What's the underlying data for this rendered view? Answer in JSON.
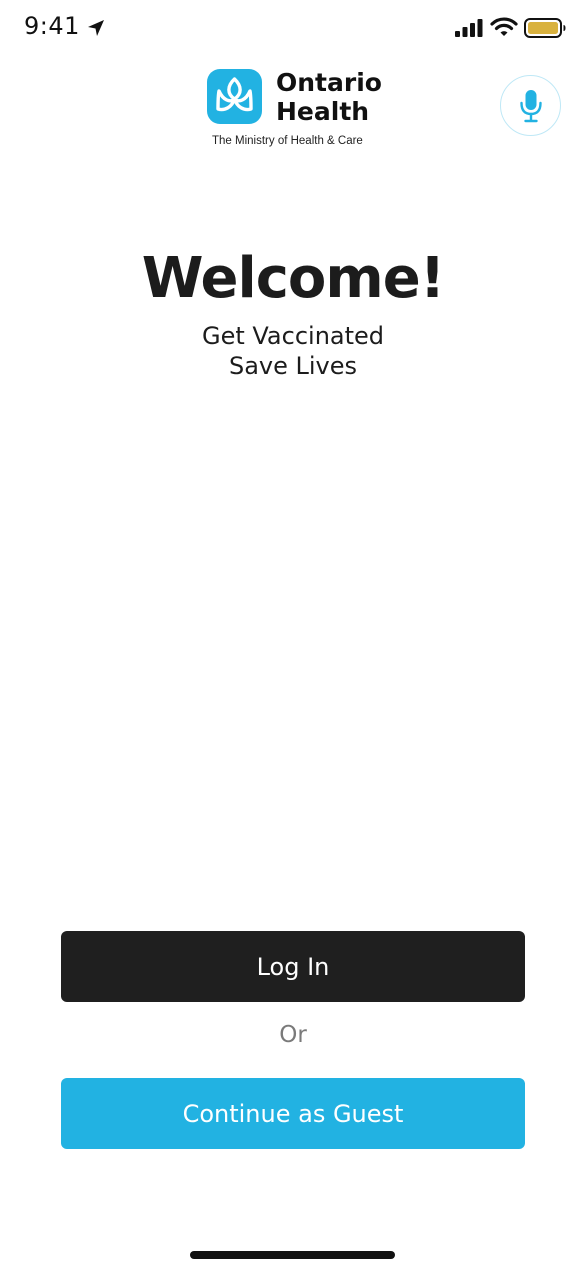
{
  "status_bar": {
    "time": "9:41",
    "icons": [
      "location-arrow-icon",
      "cellular-signal-icon",
      "wifi-icon",
      "battery-icon"
    ],
    "battery_color": "#D9B23F"
  },
  "header": {
    "logo": {
      "name": "Ontario\nHealth",
      "tagline": "The Ministry of Health & Care",
      "mark_icon": "trillium-icon"
    },
    "mic_button": {
      "icon": "microphone-icon"
    }
  },
  "main": {
    "title": "Welcome!",
    "subtitle_line1": "Get Vaccinated",
    "subtitle_line2": "Save Lives"
  },
  "actions": {
    "login_label": "Log In",
    "or_label": "Or",
    "guest_label": "Continue as Guest"
  },
  "colors": {
    "brand_blue": "#22B2E2",
    "dark_button": "#1F1F1F",
    "text": "#1C1C1C",
    "muted_text": "#7A7A7A",
    "background": "#FFFFFF"
  }
}
